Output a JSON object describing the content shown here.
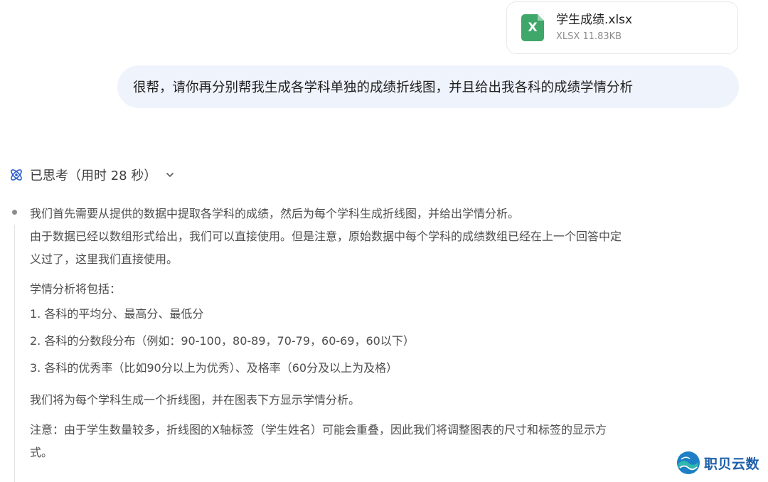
{
  "attachment": {
    "icon": "xlsx-file-icon",
    "icon_letter": "X",
    "name": "学生成绩.xlsx",
    "info": "XLSX 11.83KB",
    "accent_color": "#3ea769"
  },
  "user_message": {
    "text": "很帮，请你再分别帮我生成各学科单独的成绩折线图，并且给出我各科的成绩学情分析",
    "bubble_color": "#eff3fc"
  },
  "thinking": {
    "icon": "atom-icon",
    "label": "已思考（用时 28 秒）",
    "toggle_icon": "chevron-down-icon",
    "paragraphs": [
      "我们首先需要从提供的数据中提取各学科的成绩，然后为每个学科生成折线图，并给出学情分析。",
      "由于数据已经以数组形式给出，我们可以直接使用。但是注意，原始数据中每个学科的成绩数组已经在上一个回答中定",
      "义过了，这里我们直接使用。"
    ],
    "analysis_intro": "学情分析将包括：",
    "list": [
      "1. 各科的平均分、最高分、最低分",
      "2. 各科的分数段分布（例如：90-100，80-89，70-79，60-69，60以下）",
      "3. 各科的优秀率（比如90分以上为优秀）、及格率（60分及以上为及格）"
    ],
    "plan": "我们将为每个学科生成一个折线图，并在图表下方显示学情分析。",
    "note_line1": "注意：由于学生数量较多，折线图的X轴标签（学生姓名）可能会重叠，因此我们将调整图表的尺寸和标签的显示方",
    "note_line2": "式。"
  },
  "watermark": {
    "text": "职贝云数",
    "brand_color": "#1d5fa8"
  }
}
